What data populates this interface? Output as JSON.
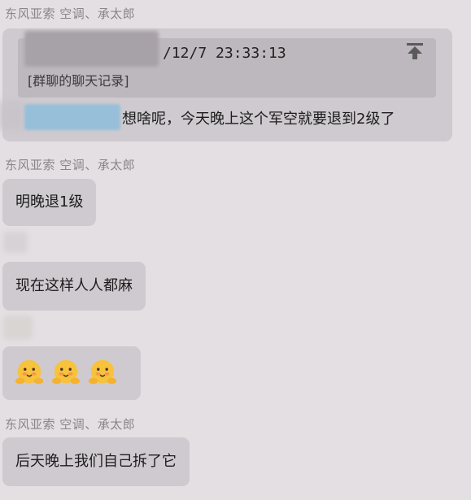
{
  "messages": [
    {
      "sender": "东风亚索 空调、承太郎",
      "quote": {
        "timestamp": "/12/7 23:33:13",
        "label": "[群聊的聊天记录]"
      },
      "text": "想啥呢，今天晚上这个军空就要退到2级了"
    },
    {
      "sender": "东风亚索 空调、承太郎",
      "text": "明晚退1级"
    },
    {
      "text": "现在这样人人都麻"
    },
    {
      "emojis": [
        "hugging-face-icon",
        "hugging-face-icon",
        "hugging-face-icon"
      ]
    },
    {
      "sender": "东风亚索 空调、承太郎",
      "text": "后天晚上我们自己拆了它"
    }
  ]
}
